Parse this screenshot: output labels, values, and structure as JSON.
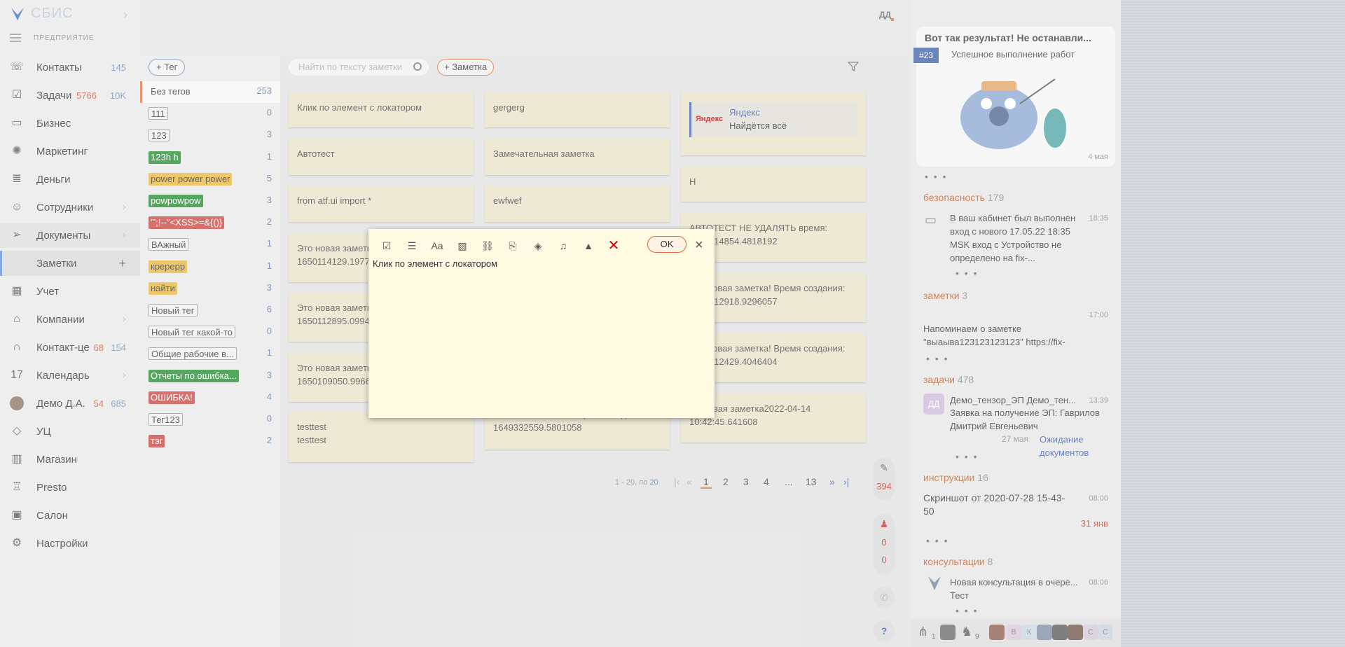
{
  "app": {
    "logo_text": "СБИС",
    "enterprise_label": "ПРЕДПРИЯТИЕ",
    "user_initials": "ДД"
  },
  "nav": [
    {
      "label": "Контакты",
      "count": "145",
      "icon": "contacts-icon"
    },
    {
      "label": "Задачи",
      "count_red": "5766",
      "count": "10K",
      "icon": "tasks-icon"
    },
    {
      "label": "Бизнес",
      "icon": "business-icon"
    },
    {
      "label": "Маркетинг",
      "icon": "marketing-icon"
    },
    {
      "label": "Деньги",
      "icon": "money-icon"
    },
    {
      "label": "Сотрудники",
      "icon": "staff-icon",
      "arrow": "›"
    },
    {
      "label": "Документы",
      "icon": "documents-icon",
      "arrow": "›"
    },
    {
      "label": "Заметки",
      "plus": "+",
      "active": true
    },
    {
      "label": "Учет",
      "icon": "accounting-icon"
    },
    {
      "label": "Компании",
      "icon": "companies-icon",
      "arrow": "›"
    },
    {
      "label": "Контакт-це",
      "count_red": "68",
      "count": "154",
      "icon": "headset-icon"
    },
    {
      "label": "Календарь",
      "icon_text": "17",
      "arrow": "›"
    },
    {
      "label": "Демо Д.А.",
      "count_red": "54",
      "count": "685",
      "icon": "user-avatar"
    },
    {
      "label": "УЦ",
      "icon": "tag-icon"
    },
    {
      "label": "Магазин",
      "icon": "shop-icon"
    },
    {
      "label": "Presto",
      "icon": "presto-icon"
    },
    {
      "label": "Салон",
      "icon": "salon-icon"
    },
    {
      "label": "Настройки",
      "icon": "gear-icon"
    }
  ],
  "tags": {
    "add_label": "+ Тег",
    "items": [
      {
        "label": "Без тегов",
        "count": "253",
        "style": "sel"
      },
      {
        "label": "111",
        "count": "0",
        "style": "outline"
      },
      {
        "label": "123",
        "count": "3",
        "style": "outline"
      },
      {
        "label": "123h h",
        "count": "1",
        "style": "green"
      },
      {
        "label": "power power power",
        "count": "5",
        "style": "yellow"
      },
      {
        "label": "powpowpow",
        "count": "3",
        "style": "green"
      },
      {
        "label": "\"';!--\"<XSS>=&{()}",
        "count": "2",
        "style": "red"
      },
      {
        "label": "ВАжный",
        "count": "1",
        "style": "outline"
      },
      {
        "label": "кререрр",
        "count": "1",
        "style": "yellow"
      },
      {
        "label": "найти",
        "count": "3",
        "style": "yellow"
      },
      {
        "label": "Новый тег",
        "count": "6",
        "style": "outline"
      },
      {
        "label": "Новый тег какой-то",
        "count": "0",
        "style": "outline"
      },
      {
        "label": "Общие рабочие в...",
        "count": "1",
        "style": "outline"
      },
      {
        "label": "Отчеты по ошибка...",
        "count": "3",
        "style": "green"
      },
      {
        "label": "ОШИБКА!",
        "count": "4",
        "style": "red"
      },
      {
        "label": "Тег123",
        "count": "0",
        "style": "outline"
      },
      {
        "label": "тэг",
        "count": "2",
        "style": "red"
      }
    ],
    "colors": {
      "green": "#1a8a2a",
      "yellow": "#e8b43a",
      "red": "#c9403b"
    }
  },
  "toolbar": {
    "search_placeholder": "Найти по тексту заметки",
    "add_note_label": "+ Заметка"
  },
  "notes": {
    "col1": [
      "Клик по элемент с локатором",
      "Автотест",
      "from atf.ui import *",
      "Это новая заметка! Время создания: 1650114129.1977",
      "Это новая заметка! Время создания: 1650112895.0994",
      "Это новая заметка! Время создания: 1650109050.9966",
      "testtest\ntesttest"
    ],
    "col2": [
      "gergerg",
      "Замечательная заметка",
      "ewfwef",
      "Это новая заметка! Время создания: 1649332559.5801058"
    ],
    "col3": [
      "Н",
      "АВТОТЕСТ НЕ УДАЛЯТЬ время: 1650114854.4818192",
      "Это новая заметка! Время создания: 1650112918.9296057",
      "Это новая заметка! Время создания: 1650112429.4046404",
      "Тестовая заметка2022-04-14 10:42:45.641608"
    ],
    "yandex": {
      "title": "Яндекс",
      "subtitle": "Найдётся всё",
      "logo": "Яндекс"
    }
  },
  "pager": {
    "info_prefix": "1 - 20, по",
    "info_count": "20",
    "pages": [
      "1",
      "2",
      "3",
      "4",
      "...",
      "13"
    ],
    "current": "1"
  },
  "widgets": {
    "tasks_count": "394",
    "w2_a": "0",
    "w2_b": "0",
    "help": "?"
  },
  "feed": {
    "promo": {
      "title": "Вот так результат! Не останавли...",
      "badge": "#23",
      "subtitle": "Успешное выполнение работ",
      "date": "4 мая"
    },
    "sections": [
      {
        "title": "безопасность",
        "count": "179",
        "time": "18:35",
        "text": "В ваш кабинет был выполнен вход с нового 17.05.22 18:35 MSK вход с Устройство не определено на fix-..."
      },
      {
        "title": "заметки",
        "count": "3",
        "time": "17:00",
        "text": "Напоминаем о заметке \"выаыва123123123123\" https://fix-"
      },
      {
        "title": "задачи",
        "count": "478",
        "time": "13:39",
        "avatar": "ДД",
        "text_a": "Демо_тензор_ЭП Демо_тен...",
        "text_b": "Заявка на получение ЭП: Гаврилов Дмитрий Евгеньевич",
        "date": "27 мая",
        "status": "Ожидание документов"
      },
      {
        "title": "инструкции",
        "count": "16",
        "time": "08:00",
        "text": "Скриншот от 2020-07-28 15-43-50",
        "red": "31 янв"
      },
      {
        "title": "консультации",
        "count": "8",
        "time": "08:06",
        "text": "Новая консультация в очере... Тест"
      }
    ],
    "more": "• • •",
    "bottom_counts": [
      "1",
      "9"
    ],
    "bottom_letters": [
      "В",
      "К",
      "С",
      "С"
    ]
  },
  "editor": {
    "ok_label": "OK",
    "close": "×",
    "text": "Клик по элемент с локатором",
    "tools": [
      "checklist-icon",
      "bullet-list-icon",
      "font-icon",
      "image-icon",
      "link-icon",
      "attach-icon",
      "tag-icon",
      "bell-icon",
      "paint-bucket-icon",
      "delete-icon"
    ]
  }
}
